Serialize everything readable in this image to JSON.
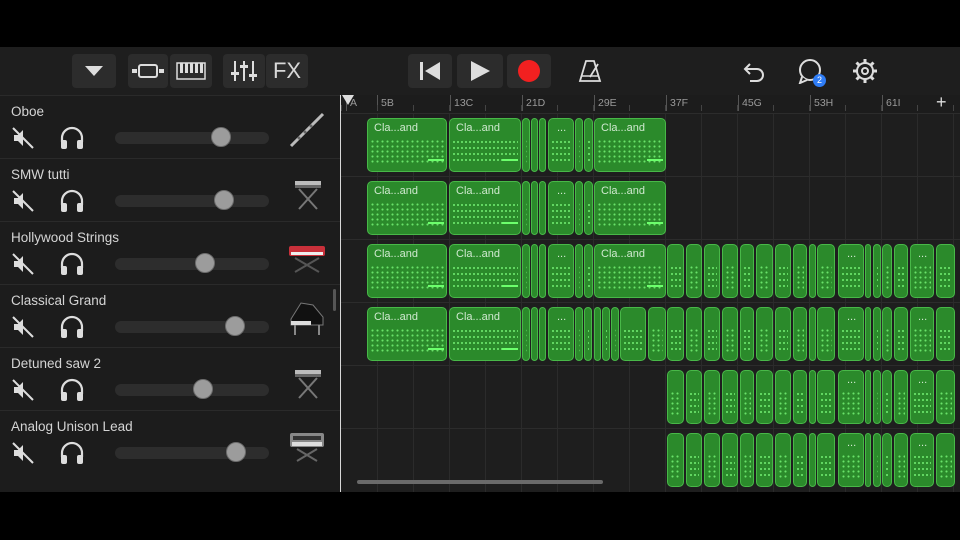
{
  "toolbar": {
    "fx_label": "FX",
    "notification_count": "2",
    "icons": [
      "dropdown-icon",
      "tracks-view-icon",
      "keyboard-icon",
      "mixer-icon",
      "rewind-icon",
      "play-icon",
      "record-icon",
      "metronome-icon",
      "undo-icon",
      "loops-icon",
      "settings-icon"
    ],
    "record_color": "#f22020",
    "badge_color": "#2f7df6"
  },
  "ruler": {
    "labels": [
      "A",
      "5B",
      "13C",
      "21D",
      "29E",
      "37F",
      "45G",
      "53H",
      "61I"
    ]
  },
  "tracks": [
    {
      "name": "Oboe",
      "instrument_icon": "oboe-icon",
      "volume": 0.72
    },
    {
      "name": "SMW tutti",
      "instrument_icon": "keyboard-stand-icon",
      "volume": 0.74
    },
    {
      "name": "Hollywood Strings",
      "instrument_icon": "synth-keyboard-icon",
      "volume": 0.6
    },
    {
      "name": "Classical Grand",
      "instrument_icon": "grand-piano-icon",
      "volume": 0.82
    },
    {
      "name": "Detuned saw  2",
      "instrument_icon": "keyboard-stand-icon",
      "volume": 0.58
    },
    {
      "name": "Analog Unison Lead",
      "instrument_icon": "synth-module-icon",
      "volume": 0.83
    }
  ],
  "regions": {
    "named": "Cla...and",
    "short": "...",
    "color": "#2b8a2b"
  }
}
